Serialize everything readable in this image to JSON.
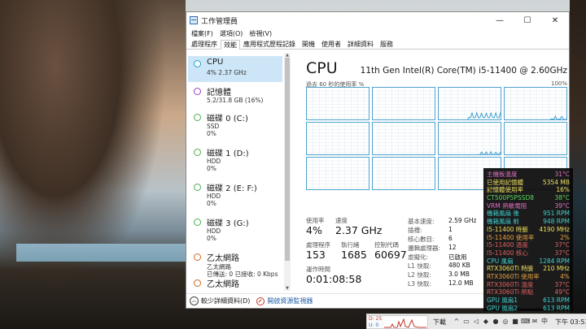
{
  "window": {
    "title": "工作管理員",
    "minimize_glyph": "—",
    "maximize_glyph": "☐",
    "close_glyph": "✕"
  },
  "menu": [
    "檔案(F)",
    "選項(O)",
    "檢視(V)"
  ],
  "tabs": [
    {
      "label": "處理程序",
      "active": false
    },
    {
      "label": "效能",
      "active": true
    },
    {
      "label": "應用程式歷程記錄",
      "active": false
    },
    {
      "label": "開機",
      "active": false
    },
    {
      "label": "使用者",
      "active": false
    },
    {
      "label": "詳細資料",
      "active": false
    },
    {
      "label": "服務",
      "active": false
    }
  ],
  "sidebar": {
    "items": [
      {
        "name": "CPU",
        "sub1": "4% 2.37 GHz",
        "sub2": "",
        "ring_color": "#17a2d8",
        "selected": true
      },
      {
        "name": "記憶體",
        "sub1": "5.2/31.8 GB (16%)",
        "sub2": "",
        "ring_color": "#9b3ec8",
        "selected": false
      },
      {
        "name": "磁碟 0 (C:)",
        "sub1": "SSD",
        "sub2": "0%",
        "ring_color": "#4caf50",
        "selected": false
      },
      {
        "name": "磁碟 1 (D:)",
        "sub1": "HDD",
        "sub2": "0%",
        "ring_color": "#4caf50",
        "selected": false
      },
      {
        "name": "磁碟 2 (E: F:)",
        "sub1": "HDD",
        "sub2": "0%",
        "ring_color": "#4caf50",
        "selected": false
      },
      {
        "name": "磁碟 3 (G:)",
        "sub1": "HDD",
        "sub2": "0%",
        "ring_color": "#4caf50",
        "selected": false
      },
      {
        "name": "乙太網路",
        "sub1": "乙太網路",
        "sub2": "已傳送: 0 已接收: 0 Kbps",
        "ring_color": "#d2691e",
        "selected": false
      },
      {
        "name": "乙太網路",
        "sub1": "",
        "sub2": "",
        "ring_color": "#d2691e",
        "selected": false
      }
    ]
  },
  "cpu": {
    "title": "CPU",
    "model": "11th Gen Intel(R) Core(TM) i5-11400 @ 2.60GHz",
    "graph_label": "過去 60 秒的使用率 %",
    "graph_max": "100%",
    "stats": {
      "usage_label": "使用率",
      "usage_value": "4%",
      "speed_label": "速度",
      "speed_value": "2.37 GHz",
      "processes_label": "處理程序",
      "processes_value": "153",
      "threads_label": "執行緒",
      "threads_value": "1685",
      "handles_label": "控制代碼",
      "handles_value": "60697",
      "uptime_label": "運作時間",
      "uptime_value": "0:01:08:58"
    },
    "specs": [
      {
        "key": "基本速度:",
        "value": "2.59 GHz"
      },
      {
        "key": "插槽:",
        "value": "1"
      },
      {
        "key": "核心數目:",
        "value": "6"
      },
      {
        "key": "邏輯處理器:",
        "value": "12"
      },
      {
        "key": "虛擬化:",
        "value": "已啟用"
      },
      {
        "key": "L1 快取:",
        "value": "480 KB"
      },
      {
        "key": "L2 快取:",
        "value": "3.0 MB"
      },
      {
        "key": "L3 快取:",
        "value": "12.0 MB"
      }
    ]
  },
  "footer": {
    "fewer_details": "較少詳細資料(D)",
    "resource_monitor": "開啟資源監視器"
  },
  "hw_monitor": [
    {
      "key": "主機板溫度",
      "value": "31°C",
      "color": "#e070c0"
    },
    {
      "key": "已使用記憶體",
      "value": "5354 MB",
      "color": "#f0e060"
    },
    {
      "key": "記憶體使用率",
      "value": "16%",
      "color": "#f0e060"
    },
    {
      "key": "CT500P5PSSD8",
      "value": "38°C",
      "color": "#5cd65c"
    },
    {
      "key": "VRM 熱敏電阻",
      "value": "39°C",
      "color": "#e070c0"
    },
    {
      "key": "機箱風扇 後",
      "value": "951 RPM",
      "color": "#40d0d0"
    },
    {
      "key": "機箱風扇 前",
      "value": "948 RPM",
      "color": "#40d0d0"
    },
    {
      "key": "I5-11400 時脈",
      "value": "4190 MHz",
      "color": "#f0e060"
    },
    {
      "key": "I5-11400 使用率",
      "value": "2%",
      "color": "#e8a040"
    },
    {
      "key": "I5-11400 溫度",
      "value": "37°C",
      "color": "#e06060"
    },
    {
      "key": "I5-11400 核心",
      "value": "37°C",
      "color": "#e06060"
    },
    {
      "key": "CPU 風扇",
      "value": "1284 RPM",
      "color": "#40d0d0"
    },
    {
      "key": "RTX3060Ti 時脈",
      "value": "210 MHz",
      "color": "#f0e060"
    },
    {
      "key": "RTX3060Ti 使用率",
      "value": "4%",
      "color": "#e8a040"
    },
    {
      "key": "RTX3060Ti 溫度",
      "value": "37°C",
      "color": "#e06060"
    },
    {
      "key": "RTX3060Ti 熱點",
      "value": "49°C",
      "color": "#e06060"
    },
    {
      "key": "GPU 風扇1",
      "value": "613 RPM",
      "color": "#40d0d0"
    },
    {
      "key": "GPU 風扇2",
      "value": "613 RPM",
      "color": "#40d0d0"
    }
  ],
  "taskbar": {
    "net_down": "D: 25",
    "net_up": "U: 0",
    "lang": "下載",
    "clock": "下午 03:53"
  }
}
